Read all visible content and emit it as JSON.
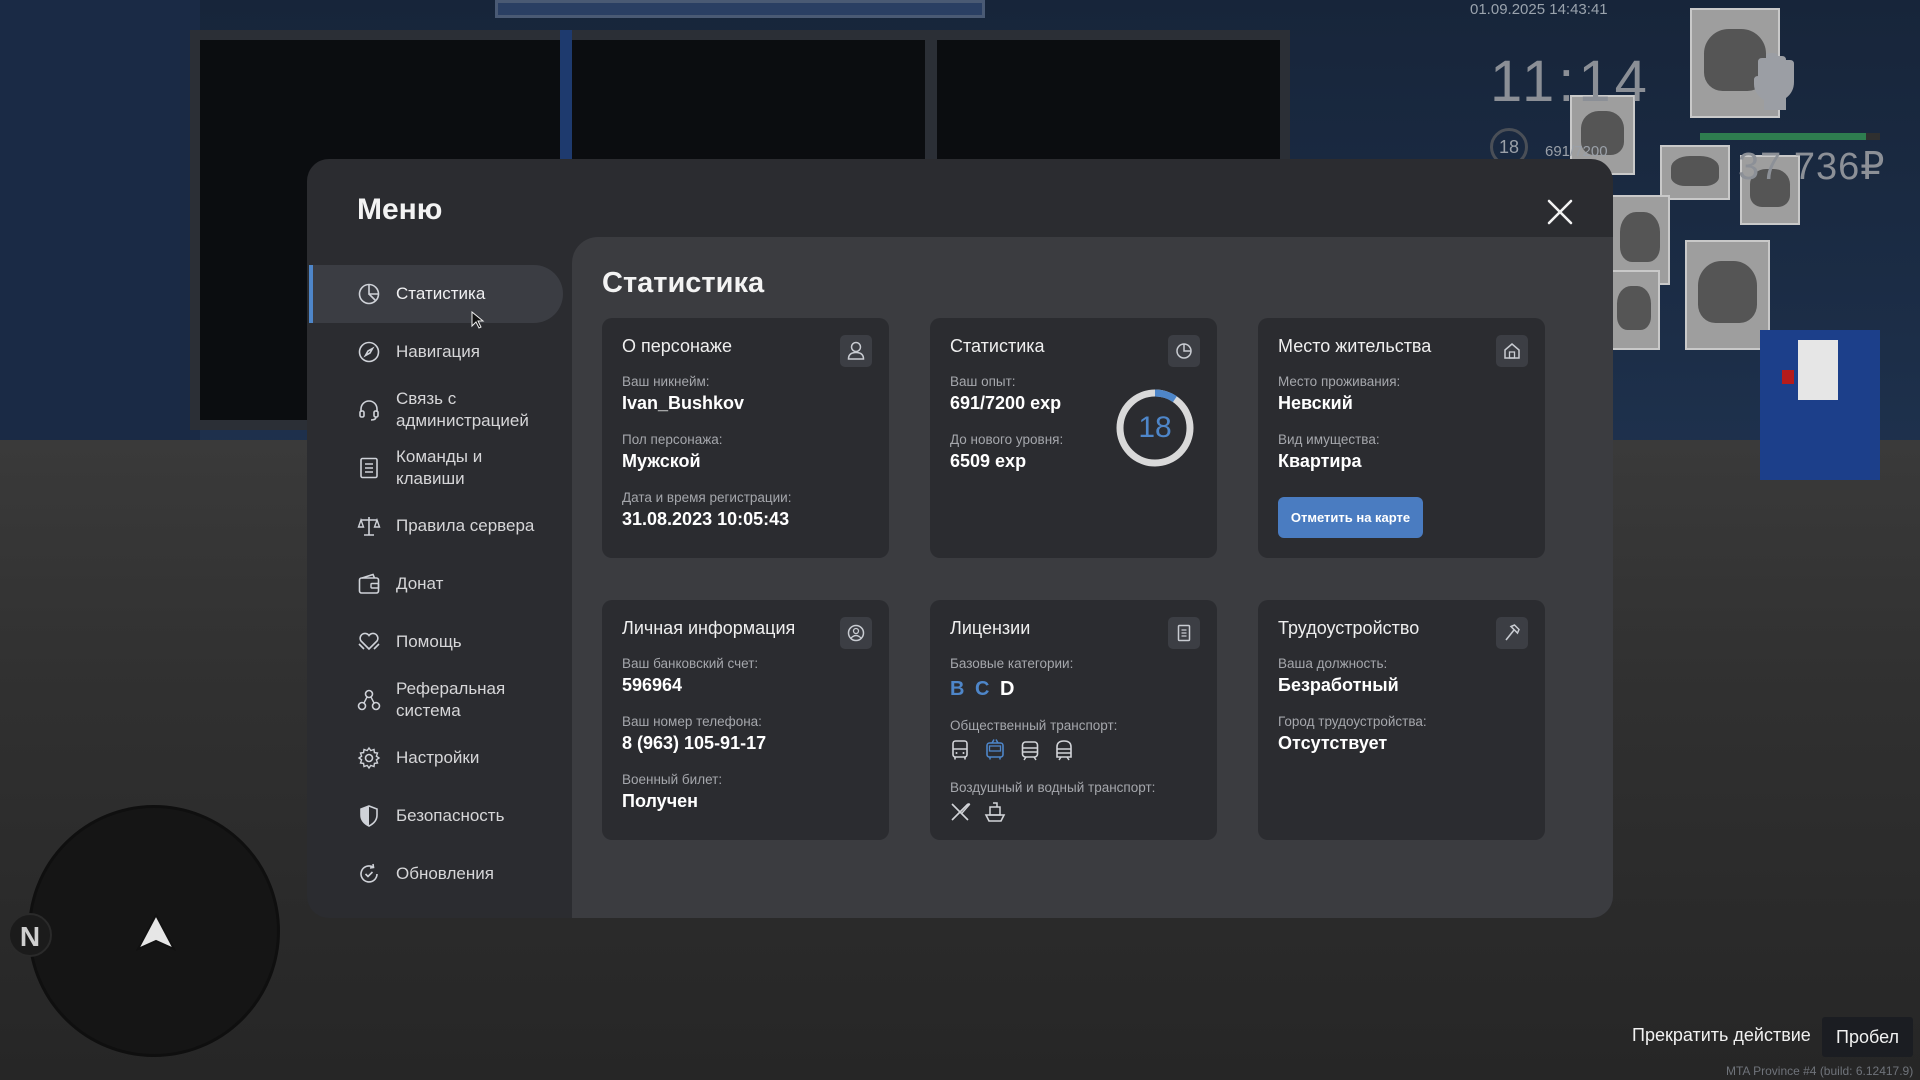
{
  "hud": {
    "datetime": "01.09.2025 14:43:41",
    "clock": "11:14",
    "level": "18",
    "exp": "691/7200",
    "money": "37 736₽",
    "health_fraction": 0.92
  },
  "minimap": {
    "north_label": "N"
  },
  "hint": {
    "text": "Прекратить действие",
    "key": "Пробел"
  },
  "build": "MTA Province #4 (build: 6.12417.9)",
  "menu": {
    "title": "Меню",
    "sidebar": [
      {
        "label": "Статистика",
        "icon": "pie-chart-icon",
        "active": true
      },
      {
        "label": "Навигация",
        "icon": "compass-icon"
      },
      {
        "label": "Связь с\nадминистрацией",
        "icon": "headset-icon"
      },
      {
        "label": "Команды и\nклавиши",
        "icon": "document-list-icon"
      },
      {
        "label": "Правила сервера",
        "icon": "scales-icon"
      },
      {
        "label": "Донат",
        "icon": "wallet-icon"
      },
      {
        "label": "Помощь",
        "icon": "heart-hands-icon"
      },
      {
        "label": "Реферальная\nсистема",
        "icon": "referral-icon"
      },
      {
        "label": "Настройки",
        "icon": "gear-icon"
      },
      {
        "label": "Безопасность",
        "icon": "shield-icon"
      },
      {
        "label": "Обновления",
        "icon": "refresh-check-icon"
      }
    ]
  },
  "content": {
    "title": "Статистика",
    "character": {
      "title": "О персонаже",
      "nick_label": "Ваш никнейм:",
      "nick": "Ivan_Bushkov",
      "gender_label": "Пол персонажа:",
      "gender": "Мужской",
      "reg_label": "Дата и время регистрации:",
      "reg": "31.08.2023 10:05:43"
    },
    "stats": {
      "title": "Статистика",
      "exp_label": "Ваш опыт:",
      "exp": "691/7200 exp",
      "next_label": "До нового уровня:",
      "next": "6509 exp",
      "level": "18",
      "progress": 0.096
    },
    "residence": {
      "title": "Место жительства",
      "place_label": "Место проживания:",
      "place": "Невский",
      "type_label": "Вид имущества:",
      "type": "Квартира",
      "button": "Отметить на карте"
    },
    "personal": {
      "title": "Личная информация",
      "bank_label": "Ваш банковский счет:",
      "bank": "596964",
      "phone_label": "Ваш номер телефона:",
      "phone": "8 (963) 105-91-17",
      "military_label": "Военный билет:",
      "military": "Получен"
    },
    "licenses": {
      "title": "Лицензии",
      "base_label": "Базовые категории:",
      "categories": [
        {
          "letter": "B",
          "color": "#4e86c9"
        },
        {
          "letter": "C",
          "color": "#4e86c9"
        },
        {
          "letter": "D",
          "color": "#ffffff"
        }
      ],
      "public_label": "Общественный транспорт:",
      "public_icons": [
        "bus-icon",
        "trolleybus-icon",
        "tram-icon",
        "metro-icon"
      ],
      "public_active": [
        false,
        true,
        false,
        false
      ],
      "air_label": "Воздушный и водный транспорт:",
      "air_icons": [
        "airplane-icon",
        "boat-icon"
      ]
    },
    "employment": {
      "title": "Трудоустройство",
      "position_label": "Ваша должность:",
      "position": "Безработный",
      "city_label": "Город трудоустройства:",
      "city": "Отсутствует"
    }
  },
  "colors": {
    "accent": "#4e86c9",
    "panel": "#2b2c30",
    "content": "#3b3c40",
    "card": "#2b2c30"
  }
}
